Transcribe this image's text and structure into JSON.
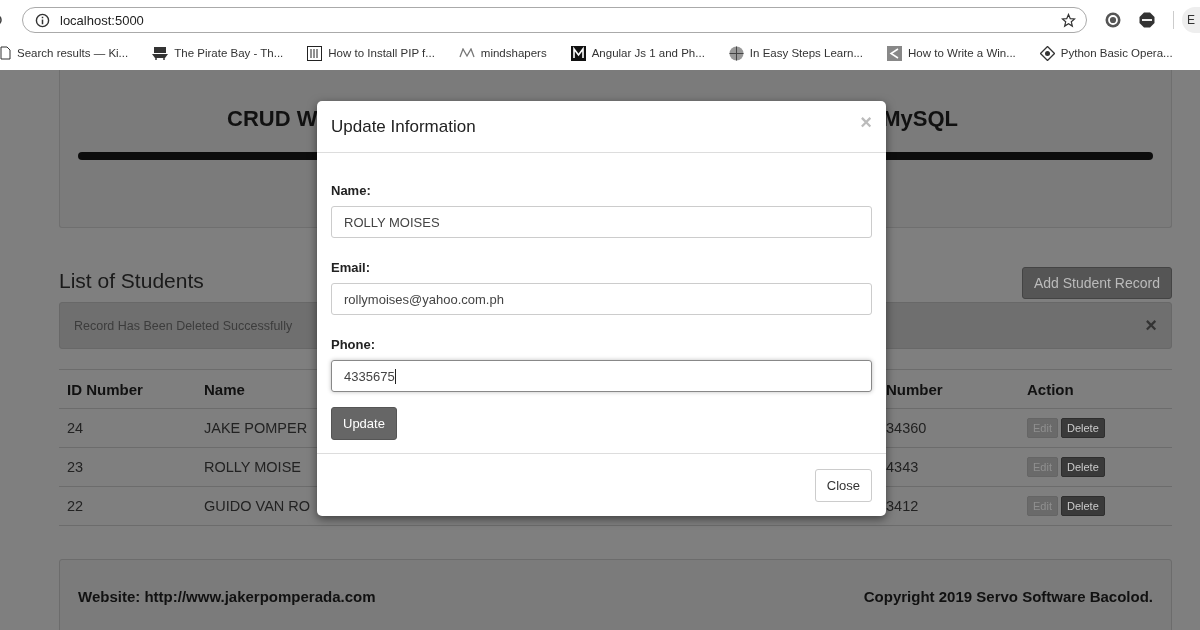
{
  "browser": {
    "url": "localhost:5000",
    "profile": "E",
    "bookmarks": [
      {
        "label": "Search results — Ki..."
      },
      {
        "label": "The Pirate Bay - Th..."
      },
      {
        "label": "How to Install PIP f..."
      },
      {
        "label": "mindshapers"
      },
      {
        "label": "Angular Js 1 and Ph..."
      },
      {
        "label": "In Easy Steps Learn..."
      },
      {
        "label": "How to Write a Win..."
      },
      {
        "label": "Python Basic Opera..."
      }
    ]
  },
  "header": {
    "title_left": "CRUD W",
    "title_right": "MySQL"
  },
  "list_title": "List of Students",
  "add_button": "Add Student Record",
  "alert": {
    "message": "Record Has Been Deleted Successfully",
    "close": "×"
  },
  "table": {
    "columns": [
      "ID Number",
      "Name",
      "Number",
      "Action"
    ],
    "rows": [
      {
        "id": "24",
        "name": "JAKE POMPER",
        "number": "34360",
        "actions": [
          "Edit",
          "Delete"
        ]
      },
      {
        "id": "23",
        "name": "ROLLY MOISE",
        "number": "4343",
        "actions": [
          "Edit",
          "Delete"
        ]
      },
      {
        "id": "22",
        "name": "GUIDO VAN RO",
        "number": "3412",
        "actions": [
          "Edit",
          "Delete"
        ]
      }
    ]
  },
  "footer": {
    "website": "Website: http://www.jakerpomperada.com",
    "copyright": "Copyright 2019 Servo Software Bacolod."
  },
  "modal": {
    "title": "Update Information",
    "close": "×",
    "fields": [
      {
        "label": "Name:",
        "value": "ROLLY MOISES",
        "focused": false
      },
      {
        "label": "Email:",
        "value": "rollymoises@yahoo.com.ph",
        "focused": false
      },
      {
        "label": "Phone:",
        "value": "4335675",
        "focused": true
      }
    ],
    "submit": "Update",
    "dismiss": "Close"
  }
}
